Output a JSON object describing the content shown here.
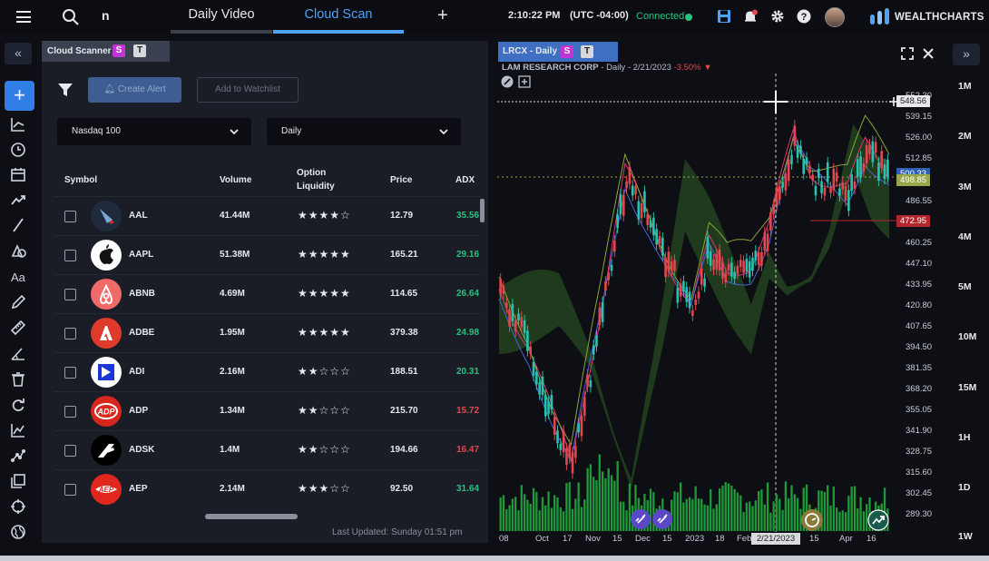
{
  "topbar": {
    "search_text": "n",
    "tabs": [
      {
        "label": "Daily Video",
        "active": false
      },
      {
        "label": "Cloud Scan",
        "active": true
      }
    ],
    "time": "2:10:22 PM",
    "timezone": "(UTC -04:00)",
    "connection_status": "Connected",
    "brand": "WEALTHCHARTS",
    "icons": [
      "menu-icon",
      "search-icon",
      "plus-icon",
      "save-icon",
      "alert-bell-icon",
      "gear-icon",
      "help-icon",
      "avatar",
      "wealthcharts-logo"
    ]
  },
  "left_toolbar": {
    "collapse_glyph": "«",
    "add_glyph": "+",
    "tools": [
      "trend-line-icon",
      "clock-icon",
      "calendar-icon",
      "arrow-trend-icon",
      "line-icon",
      "shapes-icon",
      "text-icon",
      "pencil-icon",
      "ruler-icon",
      "angle-icon",
      "trash-icon",
      "refresh-icon",
      "chart-icon",
      "nodes-icon",
      "copy-icon",
      "crosshair-icon",
      "globe-icon"
    ]
  },
  "scanner": {
    "title": "Cloud Scanner",
    "badge_s": "S",
    "badge_t": "T",
    "create_alert": "Create Alert",
    "add_watchlist": "Add to Watchlist",
    "list_select": "Nasdaq 100",
    "period_select": "Daily",
    "columns": {
      "symbol": "Symbol",
      "volume": "Volume",
      "option_liquidity_1": "Option",
      "option_liquidity_2": "Liquidity",
      "price": "Price",
      "adx": "ADX"
    },
    "rows": [
      {
        "symbol": "AAL",
        "volume": "41.44M",
        "stars": 4,
        "stars_text": "★★★★☆",
        "price": "12.79",
        "adx": "35.56",
        "adx_color": "#27c281"
      },
      {
        "symbol": "AAPL",
        "volume": "51.38M",
        "stars": 5,
        "stars_text": "★★★★★",
        "price": "165.21",
        "adx": "29.16",
        "adx_color": "#27c281"
      },
      {
        "symbol": "ABNB",
        "volume": "4.69M",
        "stars": 5,
        "stars_text": "★★★★★",
        "price": "114.65",
        "adx": "26.64",
        "adx_color": "#27c281"
      },
      {
        "symbol": "ADBE",
        "volume": "1.95M",
        "stars": 5,
        "stars_text": "★★★★★",
        "price": "379.38",
        "adx": "24.98",
        "adx_color": "#27c281"
      },
      {
        "symbol": "ADI",
        "volume": "2.16M",
        "stars": 2,
        "stars_text": "★★☆☆☆",
        "price": "188.51",
        "adx": "20.31",
        "adx_color": "#27c281"
      },
      {
        "symbol": "ADP",
        "volume": "1.34M",
        "stars": 2,
        "stars_text": "★★☆☆☆",
        "price": "215.70",
        "adx": "15.72",
        "adx_color": "#e2464e"
      },
      {
        "symbol": "ADSK",
        "volume": "1.4M",
        "stars": 2,
        "stars_text": "★★☆☆☆",
        "price": "194.66",
        "adx": "16.47",
        "adx_color": "#e2464e"
      },
      {
        "symbol": "AEP",
        "volume": "2.14M",
        "stars": 3,
        "stars_text": "★★★☆☆",
        "price": "92.50",
        "adx": "31.64",
        "adx_color": "#27c281"
      }
    ],
    "last_updated": "Last Updated: Sunday 01:51 pm"
  },
  "chart": {
    "tab_label": "LRCX - Daily",
    "badge_s": "S",
    "badge_t": "T",
    "company": "LAM RESEARCH CORP",
    "subtitle": "- Daily - 2/21/2023",
    "change": "-3.50%",
    "change_arrow": "▼",
    "price_labels": [
      "539.15",
      "526.00",
      "512.85",
      "486.55",
      "460.25",
      "447.10",
      "433.95",
      "420.80",
      "407.65",
      "394.50",
      "381.35",
      "368.20",
      "355.05",
      "341.90",
      "328.75",
      "315.60",
      "302.45",
      "289.30"
    ],
    "top_label": "552.30",
    "crosshair_price": "548.56",
    "marker_blue": "500.33",
    "marker_green": "498.85",
    "marker_red": "472.95",
    "date_labels": [
      "08",
      "Oct",
      "17",
      "Nov",
      "15",
      "Dec",
      "15",
      "2023",
      "18",
      "Feb",
      "15",
      "Apr",
      "16"
    ],
    "crosshair_date": "2/21/2023",
    "colors": {
      "up": "#27c2b0",
      "down": "#e2464e",
      "volume": "#1f9a3a",
      "cloud": "#1f3a1c",
      "accent": "#4fa3f7"
    }
  },
  "timeframes": [
    "1M",
    "2M",
    "3M",
    "4M",
    "5M",
    "10M",
    "15M",
    "1H",
    "1D",
    "1W"
  ],
  "timeframe_collapse": "»"
}
